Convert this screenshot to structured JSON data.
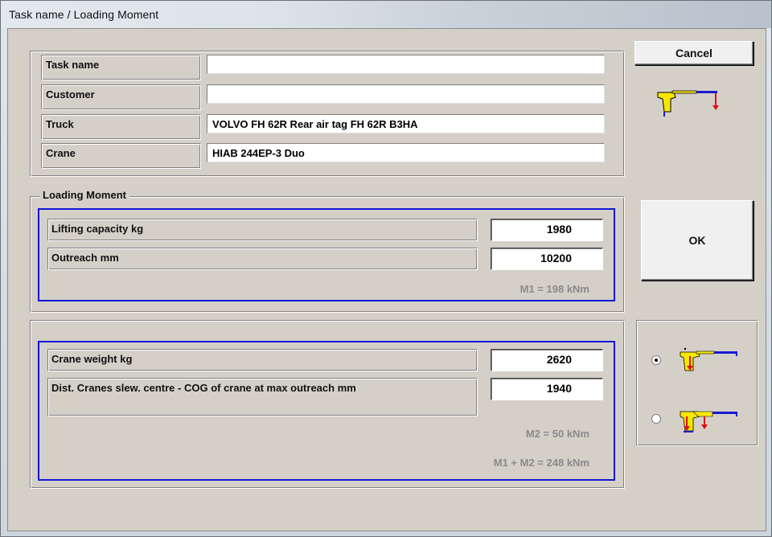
{
  "window": {
    "title": "Task name  /  Loading Moment"
  },
  "info": {
    "rows": [
      {
        "label": "Task name",
        "value": ""
      },
      {
        "label": "Customer",
        "value": ""
      },
      {
        "label": "Truck",
        "value": "VOLVO FH 62R Rear air tag FH 62R B3HA"
      },
      {
        "label": "Crane",
        "value": "HIAB  244EP-3 Duo"
      }
    ]
  },
  "loading_moment": {
    "group_label": "Loading Moment",
    "lifting_capacity_label": "Lifting capacity  kg",
    "lifting_capacity_value": "1980",
    "outreach_label": "Outreach  mm",
    "outreach_value": "10200",
    "m1_text": "M1 = 198 kNm"
  },
  "crane_moment": {
    "crane_weight_label": "Crane weight  kg",
    "crane_weight_value": "2620",
    "dist_label": "Dist. Cranes slew. centre - COG of crane at max outreach  mm",
    "dist_value": "1940",
    "m2_text": "M2 = 50 kNm",
    "total_text": "M1 + M2 = 248 kNm"
  },
  "buttons": {
    "cancel_label": "Cancel",
    "ok_label": "OK"
  },
  "options": {
    "selected_index": 0,
    "icons": [
      "crane-folded-cog-icon",
      "crane-double-cog-icon"
    ]
  },
  "colors": {
    "blue_frame": "#1515d6",
    "crane_yellow": "#f7e600",
    "crane_blue": "#1a1ad0",
    "arrow_red": "#e01010",
    "result_gray": "#8a8a8a"
  }
}
